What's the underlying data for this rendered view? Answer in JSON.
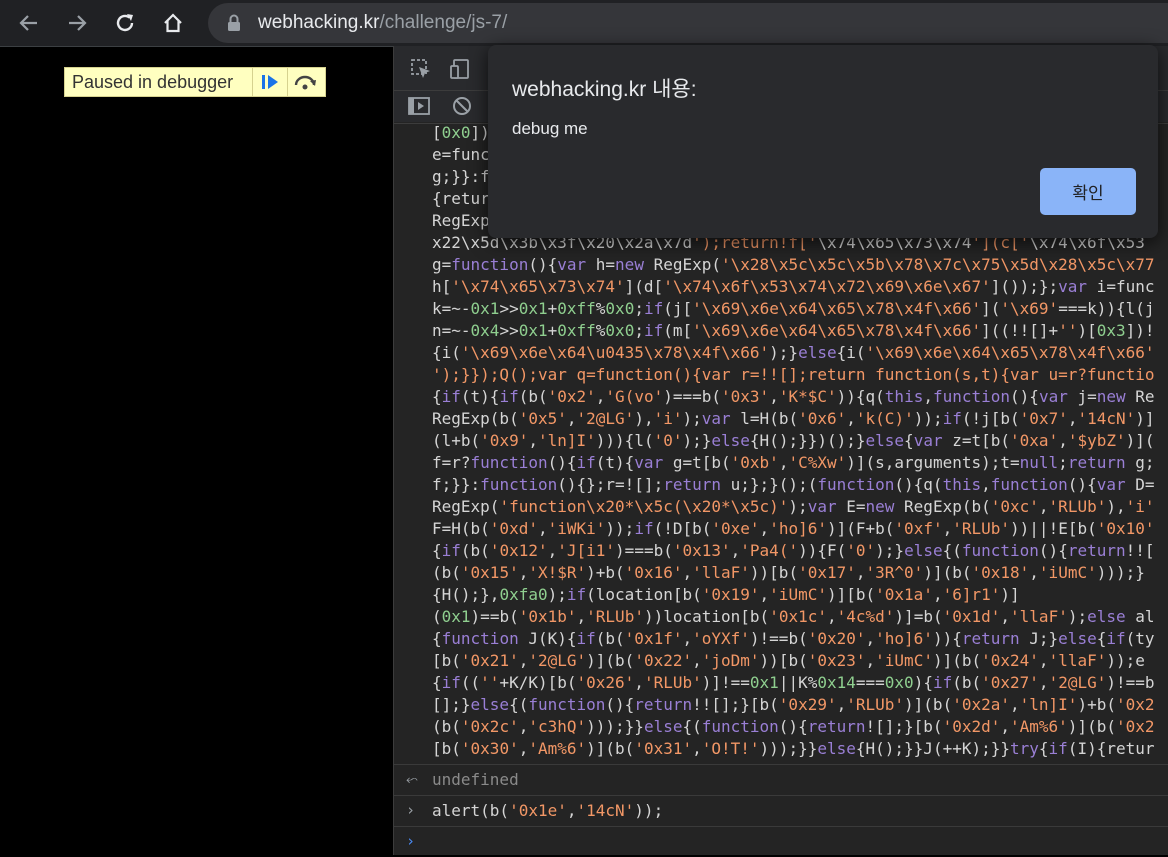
{
  "browser": {
    "url_domain": "webhacking.kr",
    "url_path": "/challenge/js-7/"
  },
  "page": {
    "paused_label": "Paused in debugger"
  },
  "dialog": {
    "title": "webhacking.kr 내용:",
    "message": "debug me",
    "ok_label": "확인"
  },
  "devtools": {
    "code_lines": [
      "[0x0]);",
      "e=func",
      "g;}}:f",
      "{retur",
      "RegExp",
      "x22\\x5d\\x3b\\x3f\\x20\\x2a\\x7d');return!f['\\x74\\x65\\x73\\x74'](c['\\x74\\x6f\\x53",
      "g=function(){var h=new RegExp('\\x28\\x5c\\x5c\\x5b\\x78\\x7c\\x75\\x5d\\x28\\x5c\\x77",
      "h['\\x74\\x65\\x73\\x74'](d['\\x74\\x6f\\x53\\x74\\x72\\x69\\x6e\\x67']());};var i=func",
      "k=~-0x1>>0x1+0xff%0x0;if(j['\\x69\\x6e\\x64\\x65\\x78\\x4f\\x66']('\\x69'===k)){l(j",
      "n=~-0x4>>0x1+0xff%0x0;if(m['\\x69\\x6e\\x64\\x65\\x78\\x4f\\x66']((!![]+'')[0x3])!",
      "{i('\\x69\\x6e\\x64\\u0435\\x78\\x4f\\x66');}else{i('\\x69\\x6e\\x64\\x65\\x78\\x4f\\x66'",
      "');}});Q();var q=function(){var r=!![];return function(s,t){var u=r?functio",
      "{if(t){if(b('0x2','G(vo')===b('0x3','K*$C')){q(this,function(){var j=new Re",
      "RegExp(b('0x5','2@LG'),'i');var l=H(b('0x6','k(C)'));if(!j[b('0x7','14cN')]",
      "(l+b('0x9','ln]I'))){l('0');}else{H();}})();}else{var z=t[b('0xa','$ybZ')](",
      "f=r?function(){if(t){var g=t[b('0xb','C%Xw')](s,arguments);t=null;return g;",
      "f;}}:function(){};r=![];return u;};}();(function(){q(this,function(){var D=",
      "RegExp('function\\x20*\\x5c(\\x20*\\x5c)');var E=new RegExp(b('0xc','RLUb'),'i'",
      "F=H(b('0xd','iWKi'));if(!D[b('0xe','ho]6')](F+b('0xf','RLUb'))||!E[b('0x10'",
      "{if(b('0x12','J[i1')===b('0x13','Pa4(')){F('0');}else{(function(){return!![",
      "(b('0x15','X!$R')+b('0x16','llaF'))[b('0x17','3R^0')](b('0x18','iUmC')));}",
      "{H();},0xfa0);if(location[b('0x19','iUmC')][b('0x1a','6]r1')]",
      "(0x1)==b('0x1b','RLUb'))location[b('0x1c','4c%d')]=b('0x1d','llaF');else al",
      "{function J(K){if(b('0x1f','oYXf')!==b('0x20','ho]6')){return J;}else{if(ty",
      "[b('0x21','2@LG')](b('0x22','joDm'))[b('0x23','iUmC')](b('0x24','llaF'));e",
      "{if((''+K/K)[b('0x26','RLUb')]!==0x1||K%0x14===0x0){if(b('0x27','2@LG')!==b",
      "[];}else{(function(){return!![];}[b('0x29','RLUb')](b('0x2a','ln]I')+b('0x2",
      "(b('0x2c','c3hQ')));}}else{(function(){return![];}[b('0x2d','Am%6')](b('0x2",
      "[b('0x30','Am%6')](b('0x31','O!T!')));}}else{H();}}J(++K);}}try{if(I){retur"
    ],
    "result_text": "undefined",
    "command_text": "alert(b('0x1e','14cN'));"
  }
}
